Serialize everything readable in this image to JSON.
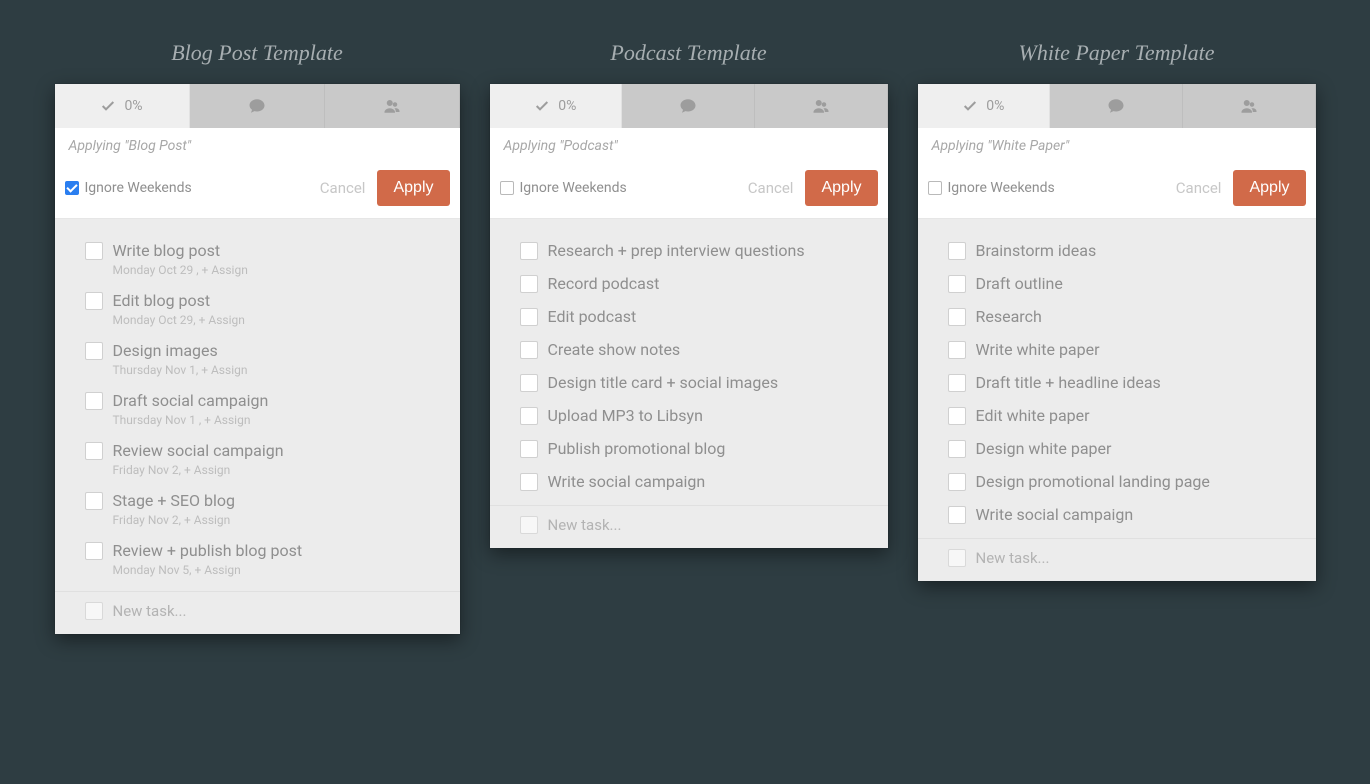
{
  "columns": [
    {
      "title": "Blog Post Template",
      "progress": "0%",
      "applying_text": "Applying \"Blog Post\"",
      "ignore_checked": true,
      "ignore_label": "Ignore Weekends",
      "cancel_label": "Cancel",
      "apply_label": "Apply",
      "tasks": [
        {
          "title": "Write blog post",
          "meta": "Monday Oct 29 ,  + Assign"
        },
        {
          "title": "Edit blog post",
          "meta": "Monday Oct 29,  + Assign"
        },
        {
          "title": "Design images",
          "meta": "Thursday Nov 1,  + Assign"
        },
        {
          "title": "Draft social campaign",
          "meta": "Thursday Nov 1 ,  + Assign"
        },
        {
          "title": "Review social campaign",
          "meta": "Friday Nov 2,  + Assign"
        },
        {
          "title": "Stage + SEO blog",
          "meta": "Friday Nov 2,  + Assign"
        },
        {
          "title": "Review + publish blog post",
          "meta": "Monday Nov 5,  + Assign"
        }
      ],
      "new_task_label": "New task..."
    },
    {
      "title": "Podcast Template",
      "progress": "0%",
      "applying_text": "Applying \"Podcast\"",
      "ignore_checked": false,
      "ignore_label": "Ignore Weekends",
      "cancel_label": "Cancel",
      "apply_label": "Apply",
      "tasks": [
        {
          "title": "Research + prep interview questions"
        },
        {
          "title": "Record podcast"
        },
        {
          "title": "Edit podcast"
        },
        {
          "title": "Create show notes"
        },
        {
          "title": "Design title card + social images"
        },
        {
          "title": "Upload MP3 to Libsyn"
        },
        {
          "title": "Publish promotional blog"
        },
        {
          "title": "Write social campaign"
        }
      ],
      "new_task_label": "New task..."
    },
    {
      "title": "White Paper Template",
      "progress": "0%",
      "applying_text": "Applying \"White Paper\"",
      "ignore_checked": false,
      "ignore_label": "Ignore Weekends",
      "cancel_label": "Cancel",
      "apply_label": "Apply",
      "tasks": [
        {
          "title": "Brainstorm ideas"
        },
        {
          "title": "Draft outline"
        },
        {
          "title": "Research"
        },
        {
          "title": "Write white paper"
        },
        {
          "title": "Draft title + headline ideas"
        },
        {
          "title": "Edit white paper"
        },
        {
          "title": "Design white paper"
        },
        {
          "title": "Design promotional landing page"
        },
        {
          "title": "Write social campaign"
        }
      ],
      "new_task_label": "New task..."
    }
  ]
}
